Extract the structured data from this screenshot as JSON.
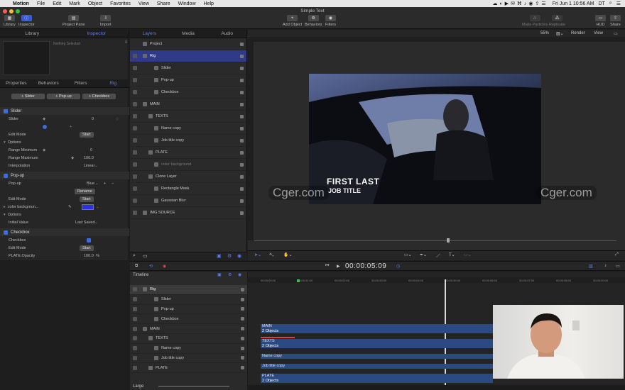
{
  "menubar": {
    "app": "Motion",
    "items": [
      "File",
      "Edit",
      "Mark",
      "Object",
      "Favorites",
      "View",
      "Share",
      "Window",
      "Help"
    ],
    "clock": "Fri Jun 1  10:56 AM",
    "user": "DT"
  },
  "window": {
    "title": "Simple Text"
  },
  "toolbar": {
    "library": "Library",
    "inspector": "Inspector",
    "project_pane": "Project Pane",
    "import": "Import",
    "add_object": "Add Object",
    "behaviors": "Behaviors",
    "filters": "Filters",
    "make_particles": "Make Particles",
    "replicate": "Replicate",
    "hud": "HUD",
    "share": "Share"
  },
  "left_panel": {
    "tabs": [
      "Library",
      "Inspector"
    ],
    "preview_text": "Nothing Selected",
    "sub_tabs": [
      "Properties",
      "Behaviors",
      "Filters",
      "Rig"
    ],
    "add_buttons": [
      "+ Slider",
      "+ Pop-up",
      "+ Checkbox"
    ],
    "slider": {
      "title": "Slider",
      "label": "Slider",
      "value": "0",
      "edit_mode": "Edit Mode",
      "start": "Start",
      "options": "Options",
      "range_min_label": "Range Minimum",
      "range_min": "0",
      "range_max_label": "Range Maximum",
      "range_max": "100.0",
      "interp_label": "Interpolation",
      "interp": "Linear"
    },
    "popup": {
      "title": "Pop-up",
      "label": "Pop-up",
      "value": "Blue",
      "rename": "Rename",
      "edit_mode": "Edit Mode",
      "start": "Start",
      "color_label": "color backgroun...",
      "options": "Options",
      "initial_label": "Initial Value",
      "initial": "Last Saved"
    },
    "checkbox": {
      "title": "Checkbox",
      "label": "Checkbox",
      "edit_mode": "Edit Mode",
      "start": "Start",
      "opacity_label": "PLATE.Opacity",
      "opacity": "100.0",
      "opacity_unit": "%"
    }
  },
  "mid_panel": {
    "tabs": [
      "Layers",
      "Media",
      "Audio"
    ],
    "layers": [
      {
        "name": "Project",
        "indent": 0
      },
      {
        "name": "Rig",
        "indent": 0,
        "selected": true
      },
      {
        "name": "Slider",
        "indent": 2
      },
      {
        "name": "Pop-up",
        "indent": 2
      },
      {
        "name": "Checkbox",
        "indent": 2
      },
      {
        "name": "MAIN",
        "indent": 0
      },
      {
        "name": "TEXTS",
        "indent": 1
      },
      {
        "name": "Name copy",
        "indent": 2
      },
      {
        "name": "Job title copy",
        "indent": 2
      },
      {
        "name": "PLATE",
        "indent": 1
      },
      {
        "name": "color background",
        "indent": 2
      },
      {
        "name": "Clone Layer",
        "indent": 1
      },
      {
        "name": "Rectangle Mask",
        "indent": 2
      },
      {
        "name": "Gaussian Blur",
        "indent": 2
      },
      {
        "name": "IMG SOURCE",
        "indent": 0
      }
    ]
  },
  "canvas": {
    "zoom": "55%",
    "render": "Render",
    "view": "View",
    "title_text": "FIRST LAST",
    "job_text": "JOB TITLE",
    "watermark": "Cger.com"
  },
  "timeline": {
    "label": "Timeline",
    "timecode": "00:00:05:09",
    "layers": [
      "Rig",
      "Slider",
      "Pop-up",
      "Checkbox",
      "MAIN",
      "TEXTS",
      "Name copy",
      "Job title copy",
      "PLATE"
    ],
    "size_label": "Large",
    "ticks": [
      "00:00:00:00",
      "00:00:01:00",
      "00:00:02:00",
      "00:00:03:00",
      "00:00:04:00",
      "00:00:05:00",
      "00:00:06:00",
      "00:00:07:00",
      "00:00:08:00",
      "00:00:09:00"
    ],
    "tracks": [
      {
        "name": "MAIN",
        "sub": "2 Objects"
      },
      {
        "name": "TEXTS",
        "sub": "2 Objects"
      },
      {
        "name": "Name copy",
        "sub": ""
      },
      {
        "name": "Job title copy",
        "sub": ""
      },
      {
        "name": "PLATE",
        "sub": "2 Objects"
      }
    ]
  }
}
